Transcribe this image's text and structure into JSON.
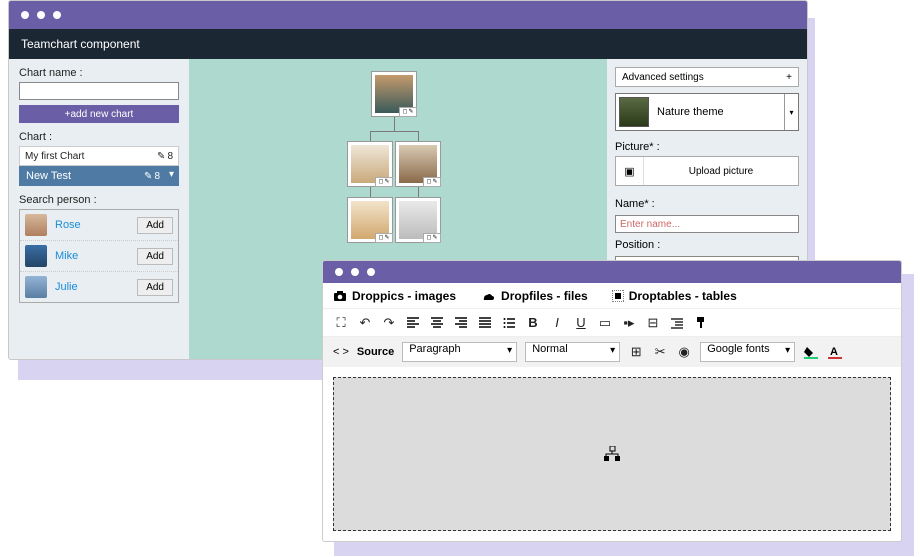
{
  "header": {
    "title": "Teamchart component"
  },
  "sidebar": {
    "chart_name_label": "Chart name :",
    "add_new_chart": "+add new chart",
    "chart_label": "Chart :",
    "charts": [
      {
        "name": "My first Chart",
        "selected": false
      },
      {
        "name": "New Test",
        "selected": true
      }
    ],
    "chart_count_badge": "8",
    "search_label": "Search person :",
    "persons": [
      {
        "name": "Rose"
      },
      {
        "name": "Mike"
      },
      {
        "name": "Julie"
      }
    ],
    "add_button": "Add"
  },
  "right": {
    "advanced_label": "Advanced settings",
    "theme_name": "Nature theme",
    "picture_label": "Picture* :",
    "upload_label": "Upload picture",
    "name_label": "Name* :",
    "name_placeholder": "Enter name...",
    "position_label": "Position :"
  },
  "editor": {
    "tabs": {
      "droppics": "Droppics - images",
      "dropfiles": "Dropfiles - files",
      "droptables": "Droptables - tables"
    },
    "source_label": "Source",
    "paragraph": "Paragraph",
    "normal": "Normal",
    "gfonts": "Google fonts"
  }
}
